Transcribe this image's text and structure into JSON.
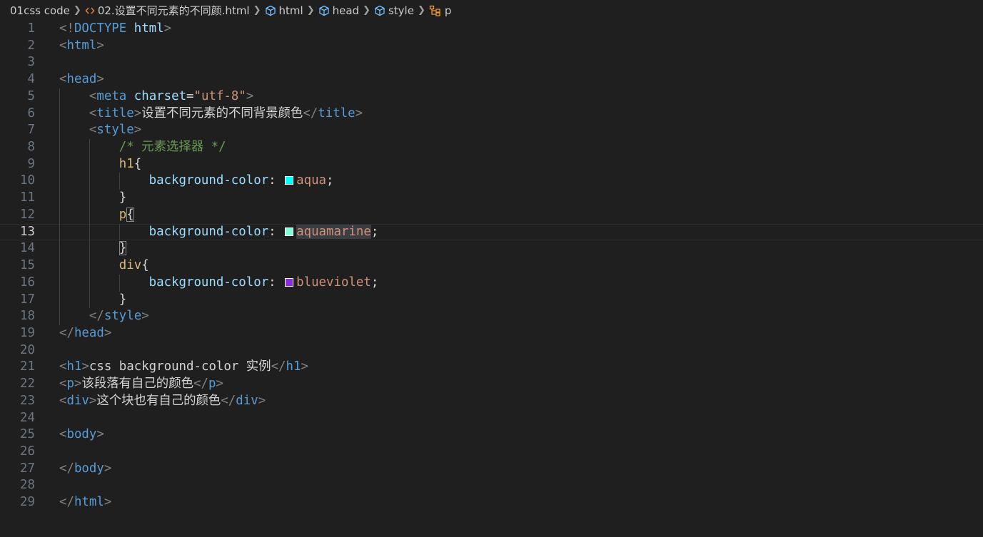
{
  "breadcrumb": [
    {
      "label": "01css code",
      "icon": "none"
    },
    {
      "label": "02.设置不同元素的不同颜.html",
      "icon": "html-file-icon",
      "color": "#e37933"
    },
    {
      "label": "html",
      "icon": "cube-icon",
      "color": "#75beff"
    },
    {
      "label": "head",
      "icon": "cube-icon",
      "color": "#75beff"
    },
    {
      "label": "style",
      "icon": "cube-icon",
      "color": "#75beff"
    },
    {
      "label": "p",
      "icon": "selector-icon",
      "color": "#ee9d28"
    }
  ],
  "current_line": 13,
  "lines": [
    [
      [
        "b",
        "<!"
      ],
      [
        "tag",
        "DOCTYPE"
      ],
      [
        "txt",
        " "
      ],
      [
        "attr",
        "html"
      ],
      [
        "b",
        ">"
      ]
    ],
    [
      [
        "b",
        "<"
      ],
      [
        "tag",
        "html"
      ],
      [
        "b",
        ">"
      ]
    ],
    [],
    [
      [
        "b",
        "<"
      ],
      [
        "tag",
        "head"
      ],
      [
        "b",
        ">"
      ]
    ],
    [
      [
        "txt",
        "    "
      ],
      [
        "b",
        "<"
      ],
      [
        "tag",
        "meta"
      ],
      [
        "txt",
        " "
      ],
      [
        "attr",
        "charset"
      ],
      [
        "punc",
        "="
      ],
      [
        "str",
        "\"utf-8\""
      ],
      [
        "b",
        ">"
      ]
    ],
    [
      [
        "txt",
        "    "
      ],
      [
        "b",
        "<"
      ],
      [
        "tag",
        "title"
      ],
      [
        "b",
        ">"
      ],
      [
        "txt",
        "设置不同元素的不同背景颜色"
      ],
      [
        "b",
        "</"
      ],
      [
        "tag",
        "title"
      ],
      [
        "b",
        ">"
      ]
    ],
    [
      [
        "txt",
        "    "
      ],
      [
        "b",
        "<"
      ],
      [
        "tag",
        "style"
      ],
      [
        "b",
        ">"
      ]
    ],
    [
      [
        "txt",
        "        "
      ],
      [
        "com",
        "/* 元素选择器 */"
      ]
    ],
    [
      [
        "txt",
        "        "
      ],
      [
        "sel",
        "h1"
      ],
      [
        "punc",
        "{"
      ]
    ],
    [
      [
        "txt",
        "            "
      ],
      [
        "prop",
        "background-color"
      ],
      [
        "punc",
        ": "
      ],
      [
        "swatch",
        "#00ffff"
      ],
      [
        "val",
        "aqua"
      ],
      [
        "punc",
        ";"
      ]
    ],
    [
      [
        "txt",
        "        "
      ],
      [
        "punc",
        "}"
      ]
    ],
    [
      [
        "txt",
        "        "
      ],
      [
        "sel",
        "p"
      ],
      [
        "brm",
        "{"
      ]
    ],
    [
      [
        "txt",
        "            "
      ],
      [
        "prop",
        "background-color"
      ],
      [
        "punc",
        ": "
      ],
      [
        "swatch",
        "#7fffd4"
      ],
      [
        "hl",
        "aquamarine"
      ],
      [
        "punc",
        ";"
      ]
    ],
    [
      [
        "txt",
        "        "
      ],
      [
        "brm",
        "}"
      ]
    ],
    [
      [
        "txt",
        "        "
      ],
      [
        "sel",
        "div"
      ],
      [
        "punc",
        "{"
      ]
    ],
    [
      [
        "txt",
        "            "
      ],
      [
        "prop",
        "background-color"
      ],
      [
        "punc",
        ": "
      ],
      [
        "swatch",
        "#8a2be2"
      ],
      [
        "val",
        "blueviolet"
      ],
      [
        "punc",
        ";"
      ]
    ],
    [
      [
        "txt",
        "        "
      ],
      [
        "punc",
        "}"
      ]
    ],
    [
      [
        "txt",
        "    "
      ],
      [
        "b",
        "</"
      ],
      [
        "tag",
        "style"
      ],
      [
        "b",
        ">"
      ]
    ],
    [
      [
        "b",
        "</"
      ],
      [
        "tag",
        "head"
      ],
      [
        "b",
        ">"
      ]
    ],
    [],
    [
      [
        "b",
        "<"
      ],
      [
        "tag",
        "h1"
      ],
      [
        "b",
        ">"
      ],
      [
        "txt",
        "css background-color 实例"
      ],
      [
        "b",
        "</"
      ],
      [
        "tag",
        "h1"
      ],
      [
        "b",
        ">"
      ]
    ],
    [
      [
        "b",
        "<"
      ],
      [
        "tag",
        "p"
      ],
      [
        "b",
        ">"
      ],
      [
        "txt",
        "该段落有自己的颜色"
      ],
      [
        "b",
        "</"
      ],
      [
        "tag",
        "p"
      ],
      [
        "b",
        ">"
      ]
    ],
    [
      [
        "b",
        "<"
      ],
      [
        "tag",
        "div"
      ],
      [
        "b",
        ">"
      ],
      [
        "txt",
        "这个块也有自己的颜色"
      ],
      [
        "b",
        "</"
      ],
      [
        "tag",
        "div"
      ],
      [
        "b",
        ">"
      ]
    ],
    [],
    [
      [
        "b",
        "<"
      ],
      [
        "tag",
        "body"
      ],
      [
        "b",
        ">"
      ]
    ],
    [],
    [
      [
        "b",
        "</"
      ],
      [
        "tag",
        "body"
      ],
      [
        "b",
        ">"
      ]
    ],
    [],
    [
      [
        "b",
        "</"
      ],
      [
        "tag",
        "html"
      ],
      [
        "b",
        ">"
      ]
    ]
  ]
}
